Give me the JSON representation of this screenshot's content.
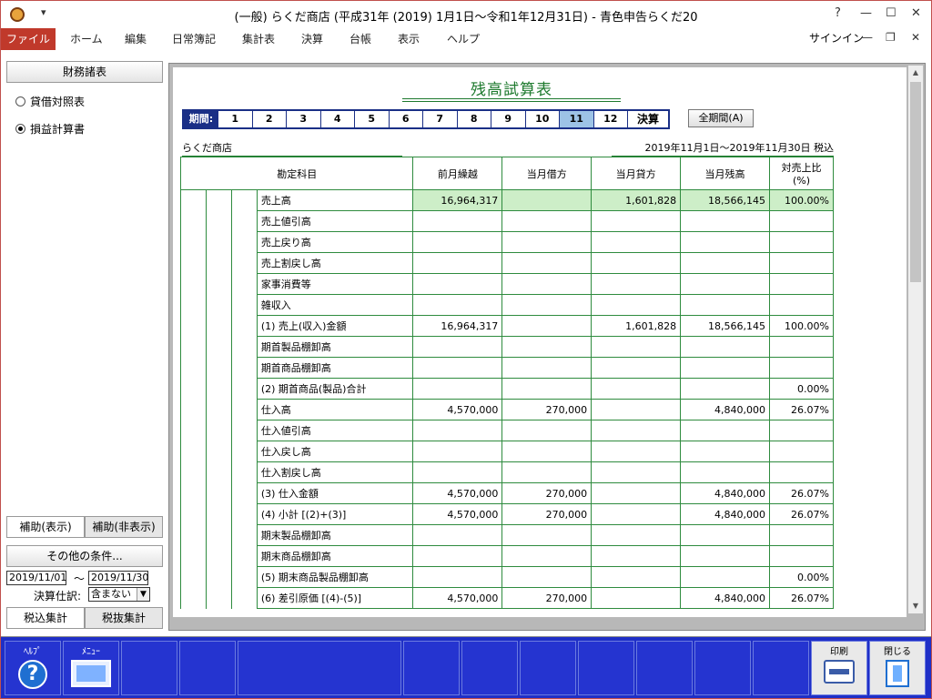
{
  "window": {
    "title": "(一般) らくだ商店 (平成31年 (2019) 1月1日～令和1年12月31日) - 青色申告らくだ20",
    "qat": "▾",
    "help_btn": "?",
    "minimize_btn": "—",
    "maximize_btn": "☐",
    "close_btn": "✕"
  },
  "menu": {
    "items": [
      "ファイル",
      "ホーム",
      "編集",
      "日常簿記",
      "集計表",
      "決算",
      "台帳",
      "表示",
      "ヘルプ"
    ],
    "signin": "サインイン",
    "min": "—",
    "restore": "❐",
    "close": "✕"
  },
  "left": {
    "header": "財務諸表",
    "radio1": "貸借対照表",
    "radio2": "損益計算書",
    "selected": "損益計算書",
    "tab_show": "補助(表示)",
    "tab_hide": "補助(非表示)",
    "other_conditions": "その他の条件...",
    "date_from": "2019/11/01",
    "tilde": "～",
    "date_to": "2019/11/30",
    "kessan_label": "決算仕訳:",
    "kessan_value": "含まない",
    "tax_in": "税込集計",
    "tax_out": "税抜集計"
  },
  "report": {
    "title": "残高試算表",
    "period_label": "期間:",
    "periods": [
      "1",
      "2",
      "3",
      "4",
      "5",
      "6",
      "7",
      "8",
      "9",
      "10",
      "11",
      "12"
    ],
    "selected_period": "11",
    "period_end": "決算",
    "all_period": "全期間(A)",
    "company": "らくだ商店",
    "range": "2019年11月1日～2019年11月30日  税込",
    "headers": [
      "勘定科目",
      "前月繰越",
      "当月借方",
      "当月貸方",
      "当月残高",
      "対売上比(%)"
    ],
    "rows": [
      {
        "name": "売上高",
        "prev": "16,964,317",
        "debit": "",
        "credit": "1,601,828",
        "balance": "18,566,145",
        "ratio": "100.00%"
      },
      {
        "name": "売上値引高",
        "prev": "",
        "debit": "",
        "credit": "",
        "balance": "",
        "ratio": ""
      },
      {
        "name": "売上戻り高",
        "prev": "",
        "debit": "",
        "credit": "",
        "balance": "",
        "ratio": ""
      },
      {
        "name": "売上割戻し高",
        "prev": "",
        "debit": "",
        "credit": "",
        "balance": "",
        "ratio": ""
      },
      {
        "name": "家事消費等",
        "prev": "",
        "debit": "",
        "credit": "",
        "balance": "",
        "ratio": ""
      },
      {
        "name": "雑収入",
        "prev": "",
        "debit": "",
        "credit": "",
        "balance": "",
        "ratio": ""
      },
      {
        "name": "(1) 売上(収入)金額",
        "prev": "16,964,317",
        "debit": "",
        "credit": "1,601,828",
        "balance": "18,566,145",
        "ratio": "100.00%"
      },
      {
        "name": "期首製品棚卸高",
        "prev": "",
        "debit": "",
        "credit": "",
        "balance": "",
        "ratio": ""
      },
      {
        "name": "期首商品棚卸高",
        "prev": "",
        "debit": "",
        "credit": "",
        "balance": "",
        "ratio": ""
      },
      {
        "name": "(2) 期首商品(製品)合計",
        "prev": "",
        "debit": "",
        "credit": "",
        "balance": "",
        "ratio": "0.00%"
      },
      {
        "name": "仕入高",
        "prev": "4,570,000",
        "debit": "270,000",
        "credit": "",
        "balance": "4,840,000",
        "ratio": "26.07%"
      },
      {
        "name": "仕入値引高",
        "prev": "",
        "debit": "",
        "credit": "",
        "balance": "",
        "ratio": ""
      },
      {
        "name": "仕入戻し高",
        "prev": "",
        "debit": "",
        "credit": "",
        "balance": "",
        "ratio": ""
      },
      {
        "name": "仕入割戻し高",
        "prev": "",
        "debit": "",
        "credit": "",
        "balance": "",
        "ratio": ""
      },
      {
        "name": "(3) 仕入金額",
        "prev": "4,570,000",
        "debit": "270,000",
        "credit": "",
        "balance": "4,840,000",
        "ratio": "26.07%"
      },
      {
        "name": "(4) 小計 [(2)+(3)]",
        "prev": "4,570,000",
        "debit": "270,000",
        "credit": "",
        "balance": "4,840,000",
        "ratio": "26.07%"
      },
      {
        "name": "期末製品棚卸高",
        "prev": "",
        "debit": "",
        "credit": "",
        "balance": "",
        "ratio": ""
      },
      {
        "name": "期末商品棚卸高",
        "prev": "",
        "debit": "",
        "credit": "",
        "balance": "",
        "ratio": ""
      },
      {
        "name": "(5) 期末商品製品棚卸高",
        "prev": "",
        "debit": "",
        "credit": "",
        "balance": "",
        "ratio": "0.00%"
      },
      {
        "name": "(6) 差引原価 [(4)-(5)]",
        "prev": "4,570,000",
        "debit": "270,000",
        "credit": "",
        "balance": "4,840,000",
        "ratio": "26.07%"
      }
    ]
  },
  "bottom": {
    "help": "ﾍﾙﾌﾟ",
    "menu": "ﾒﾆｭｰ",
    "print": "印刷",
    "close": "閉じる",
    "help_glyph": "?"
  },
  "colors": {
    "accent_red": "#c0392b",
    "table_green": "#2e8b3e",
    "bottom_blue": "#1f2fc7",
    "highlight": "#cdeec8",
    "period_sel": "#9dc3e6"
  }
}
